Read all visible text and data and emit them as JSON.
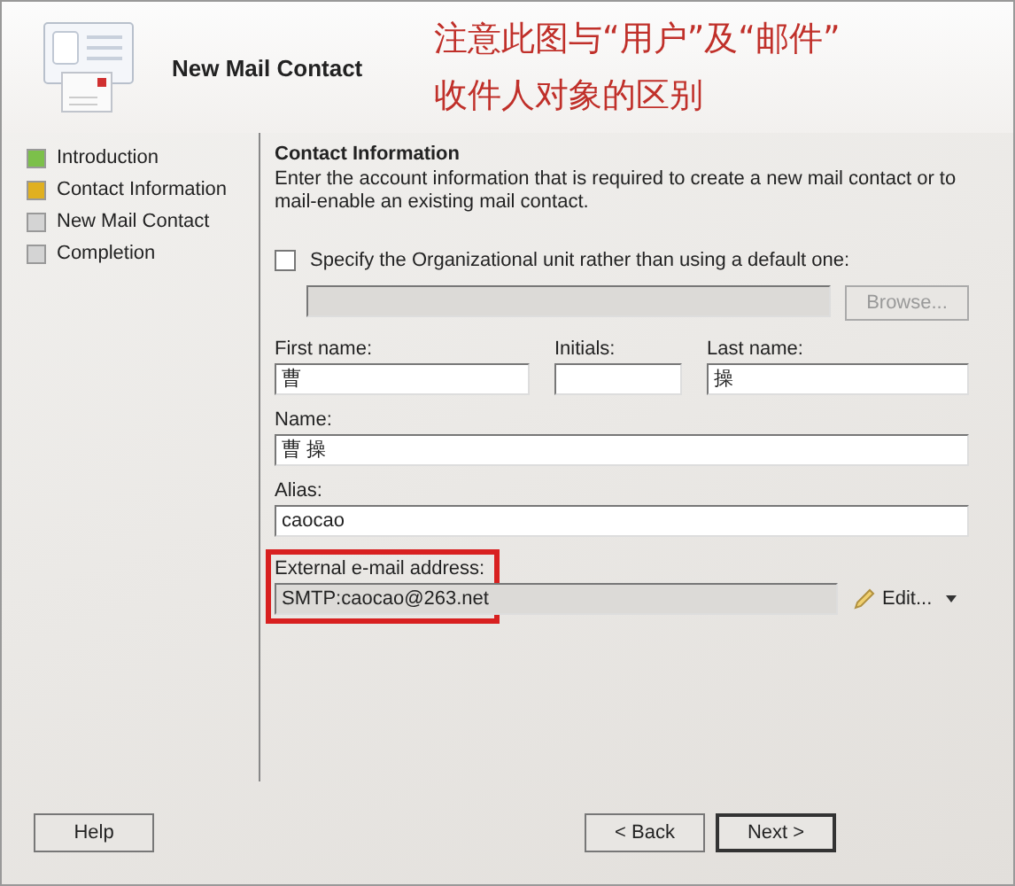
{
  "header": {
    "title": "New Mail Contact",
    "annotation_lines": [
      "注意此图与“用户”及“邮件”",
      "收件人对象的区别"
    ]
  },
  "steps": [
    {
      "label": "Introduction",
      "color": "#7cc04a"
    },
    {
      "label": "Contact Information",
      "color": "#e0b020"
    },
    {
      "label": "New Mail Contact",
      "color": "#d4d4d4"
    },
    {
      "label": "Completion",
      "color": "#d4d4d4"
    }
  ],
  "section": {
    "title": "Contact Information",
    "description": "Enter the account information that is required to create a new mail contact or to mail-enable an existing mail contact."
  },
  "ou": {
    "label": "Specify the Organizational unit rather than using a default one:",
    "checked": false,
    "value_disabled": true,
    "browse": "Browse...",
    "browse_disabled": true
  },
  "first_name": {
    "label": "First name:",
    "value": "曹"
  },
  "initials": {
    "label": "Initials:"
  },
  "last_name": {
    "label": "Last name:",
    "value": "操"
  },
  "name": {
    "label": "Name:",
    "value": "曹 操"
  },
  "alias": {
    "label": "Alias:",
    "value": "caocao"
  },
  "external": {
    "label": "External e-mail address:",
    "value": "SMTP:caocao@263.net",
    "edit": "Edit...",
    "highlighted": true
  },
  "buttons": [
    {
      "label": "Help",
      "default": false
    },
    {
      "label": "< Back",
      "default": false
    },
    {
      "label": "Next >",
      "default": true
    }
  ]
}
